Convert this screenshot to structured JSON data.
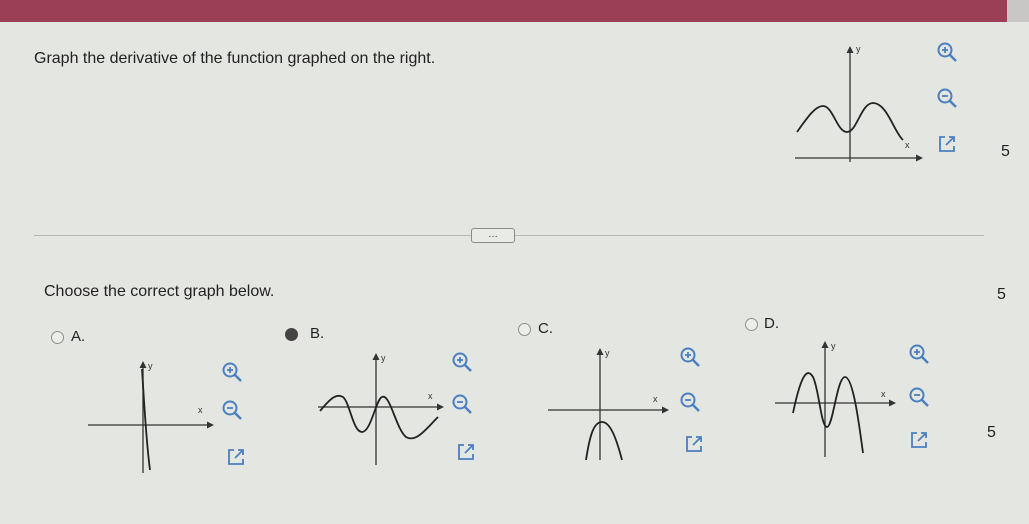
{
  "question": {
    "text": "Graph the derivative of the function graphed on the right.",
    "count": "5"
  },
  "more_button": {
    "label": "…"
  },
  "prompt": {
    "text": "Choose the correct graph below.",
    "count": "5"
  },
  "axes": {
    "x": "x",
    "y": "y"
  },
  "options": [
    {
      "letter": "A.",
      "selected": false
    },
    {
      "letter": "B.",
      "selected": true
    },
    {
      "letter": "C.",
      "selected": false
    },
    {
      "letter": "D.",
      "selected": false
    }
  ],
  "options_count": "5",
  "icons": {
    "zoom_in": "zoom-in-icon",
    "zoom_out": "zoom-out-icon",
    "open_external": "open-external-icon"
  },
  "colors": {
    "header": "#9b3f57",
    "selected_radio": "#444444",
    "tool_icon": "#4a7fc1"
  }
}
